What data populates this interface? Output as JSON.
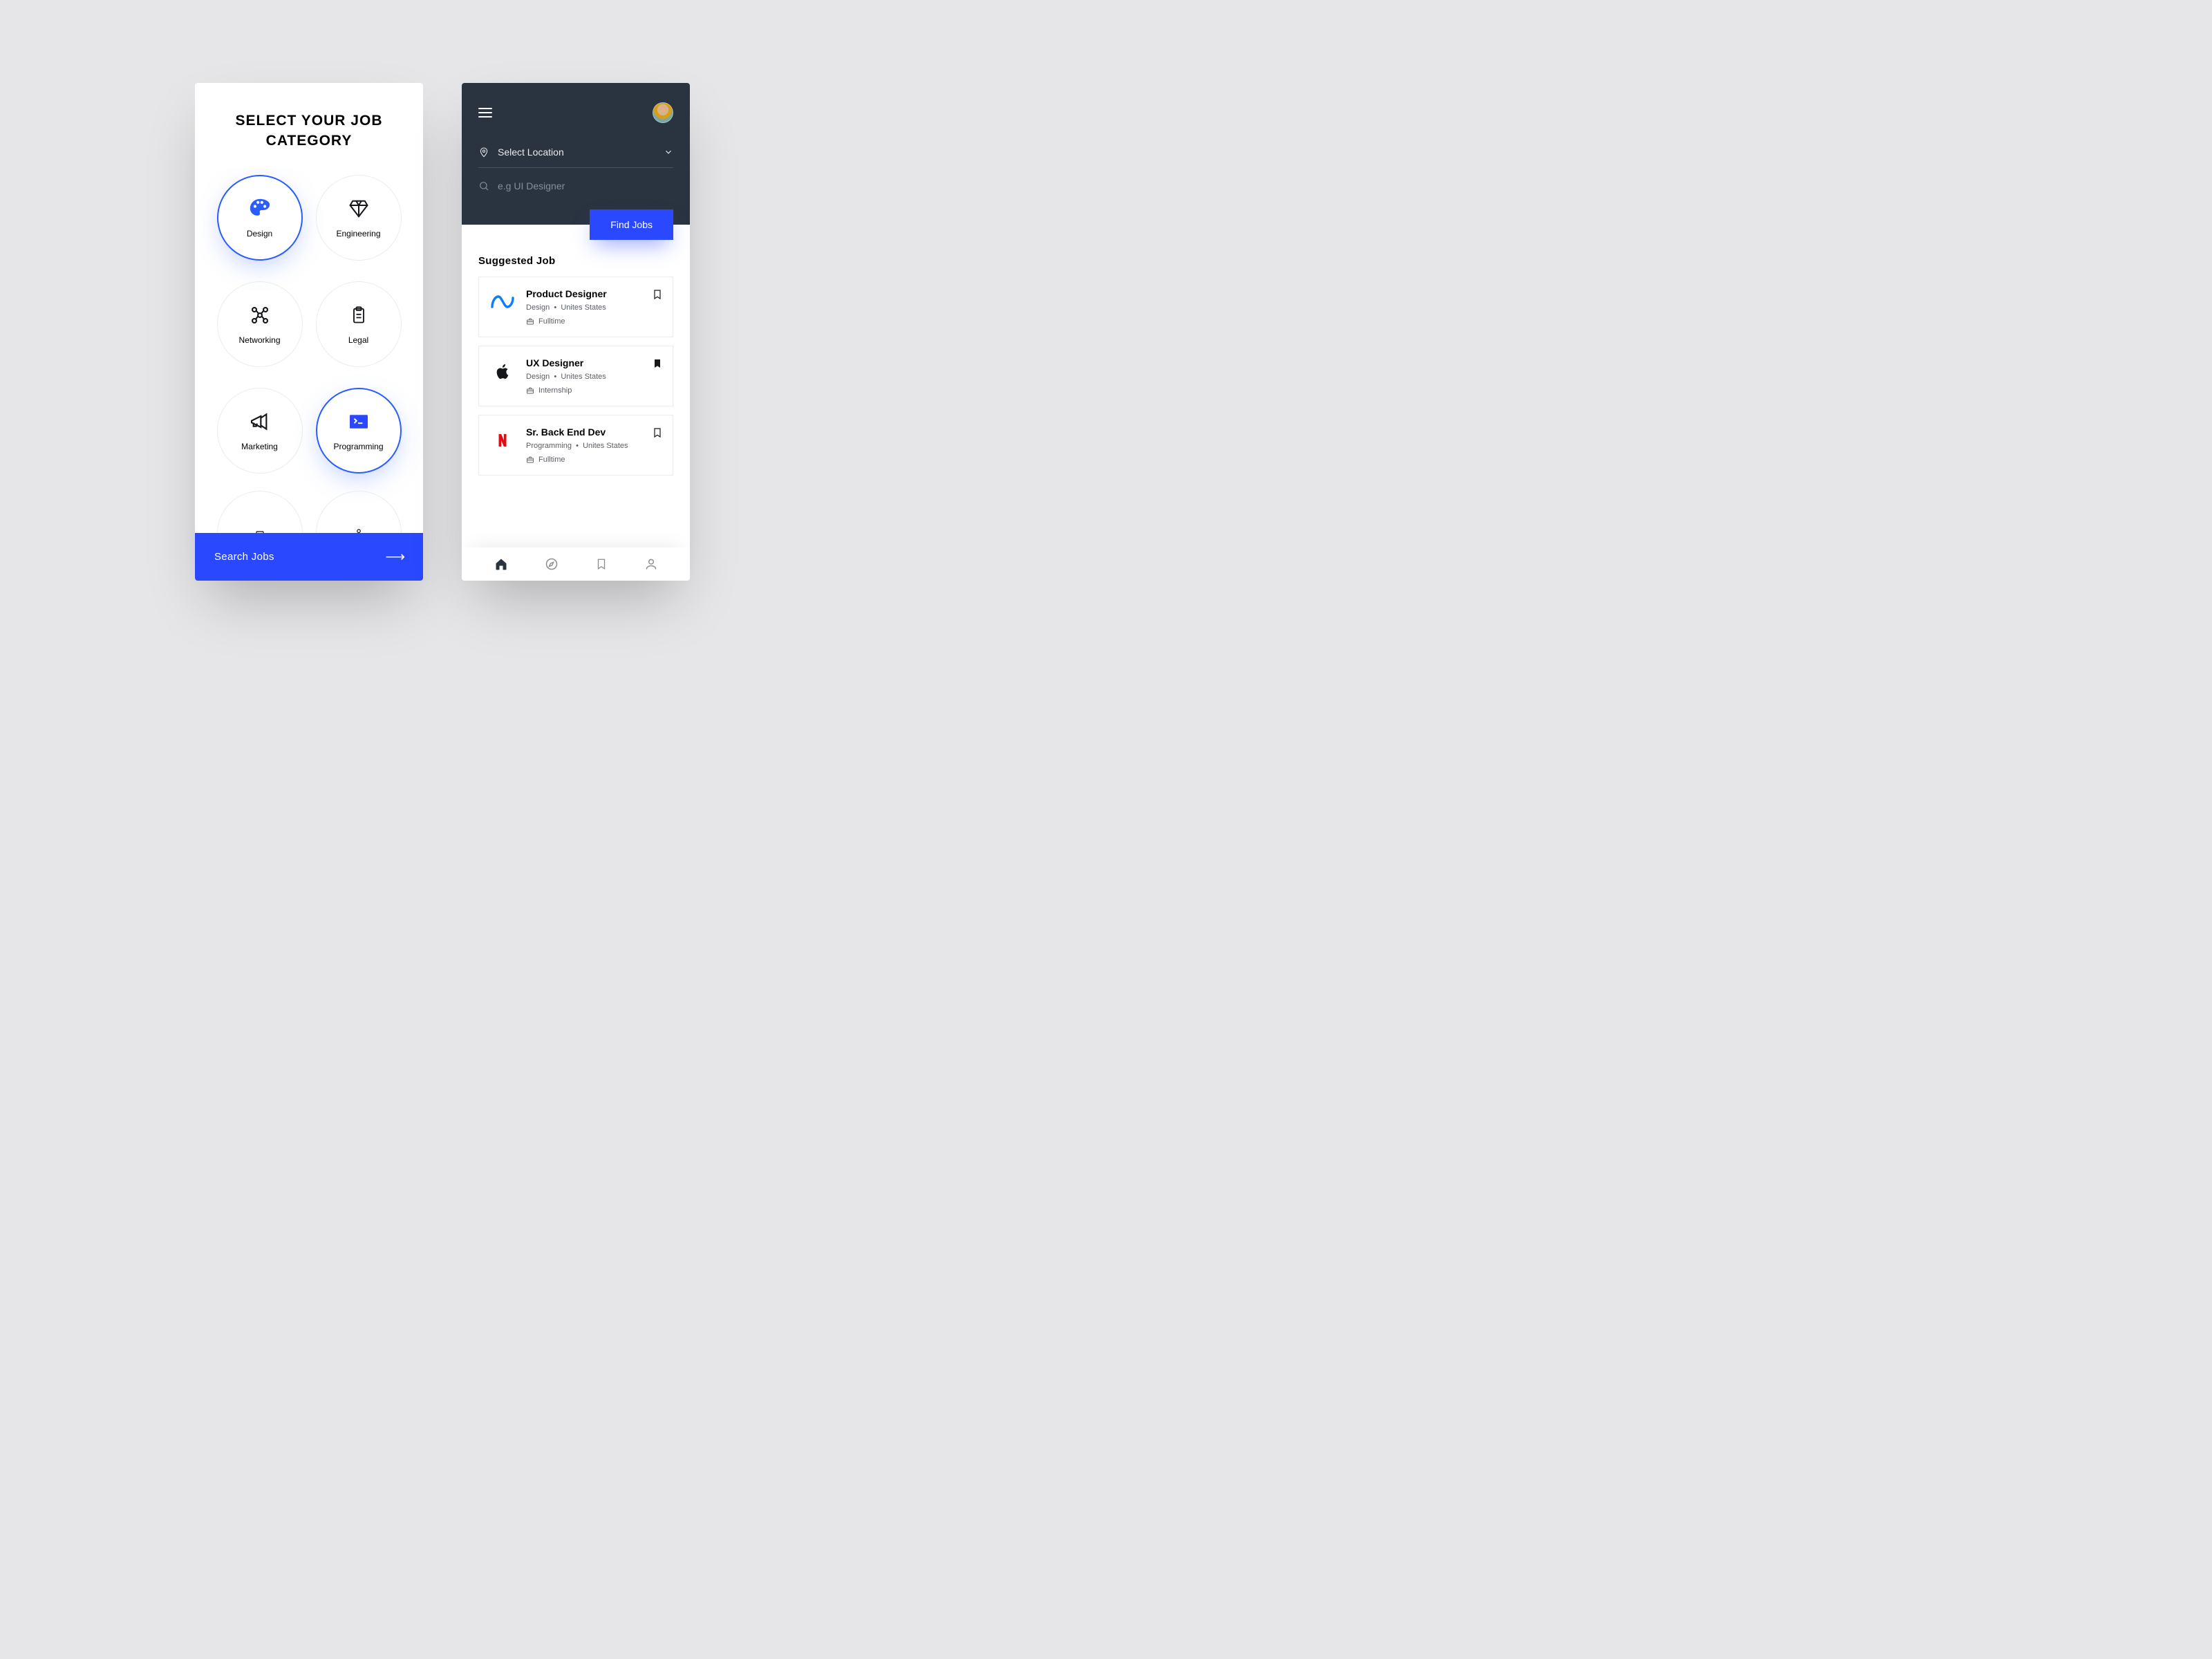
{
  "screen1": {
    "title_line1": "SELECT YOUR JOB",
    "title_line2": "CATEGORY",
    "categories": [
      {
        "label": "Design",
        "icon": "palette",
        "selected": true
      },
      {
        "label": "Engineering",
        "icon": "diamond",
        "selected": false
      },
      {
        "label": "Networking",
        "icon": "nodes",
        "selected": false
      },
      {
        "label": "Legal",
        "icon": "clipboard",
        "selected": false
      },
      {
        "label": "Marketing",
        "icon": "megaphone",
        "selected": false
      },
      {
        "label": "Programming",
        "icon": "terminal",
        "selected": true
      }
    ],
    "search_cta": "Search Jobs"
  },
  "screen2": {
    "location_label": "Select Location",
    "search_placeholder": "e.g UI Designer",
    "find_cta": "Find Jobs",
    "section_title": "Suggested Job",
    "jobs": [
      {
        "title": "Product Designer",
        "category": "Design",
        "location": "Unites States",
        "type": "Fulltime",
        "logo": "meta",
        "bookmarked": false
      },
      {
        "title": "UX Designer",
        "category": "Design",
        "location": "Unites States",
        "type": "Internship",
        "logo": "apple",
        "bookmarked": true
      },
      {
        "title": "Sr. Back End Dev",
        "category": "Programming",
        "location": "Unites States",
        "type": "Fulltime",
        "logo": "netflix",
        "bookmarked": false
      }
    ]
  },
  "colors": {
    "accent": "#2a49ff",
    "dark": "#2a3440"
  }
}
